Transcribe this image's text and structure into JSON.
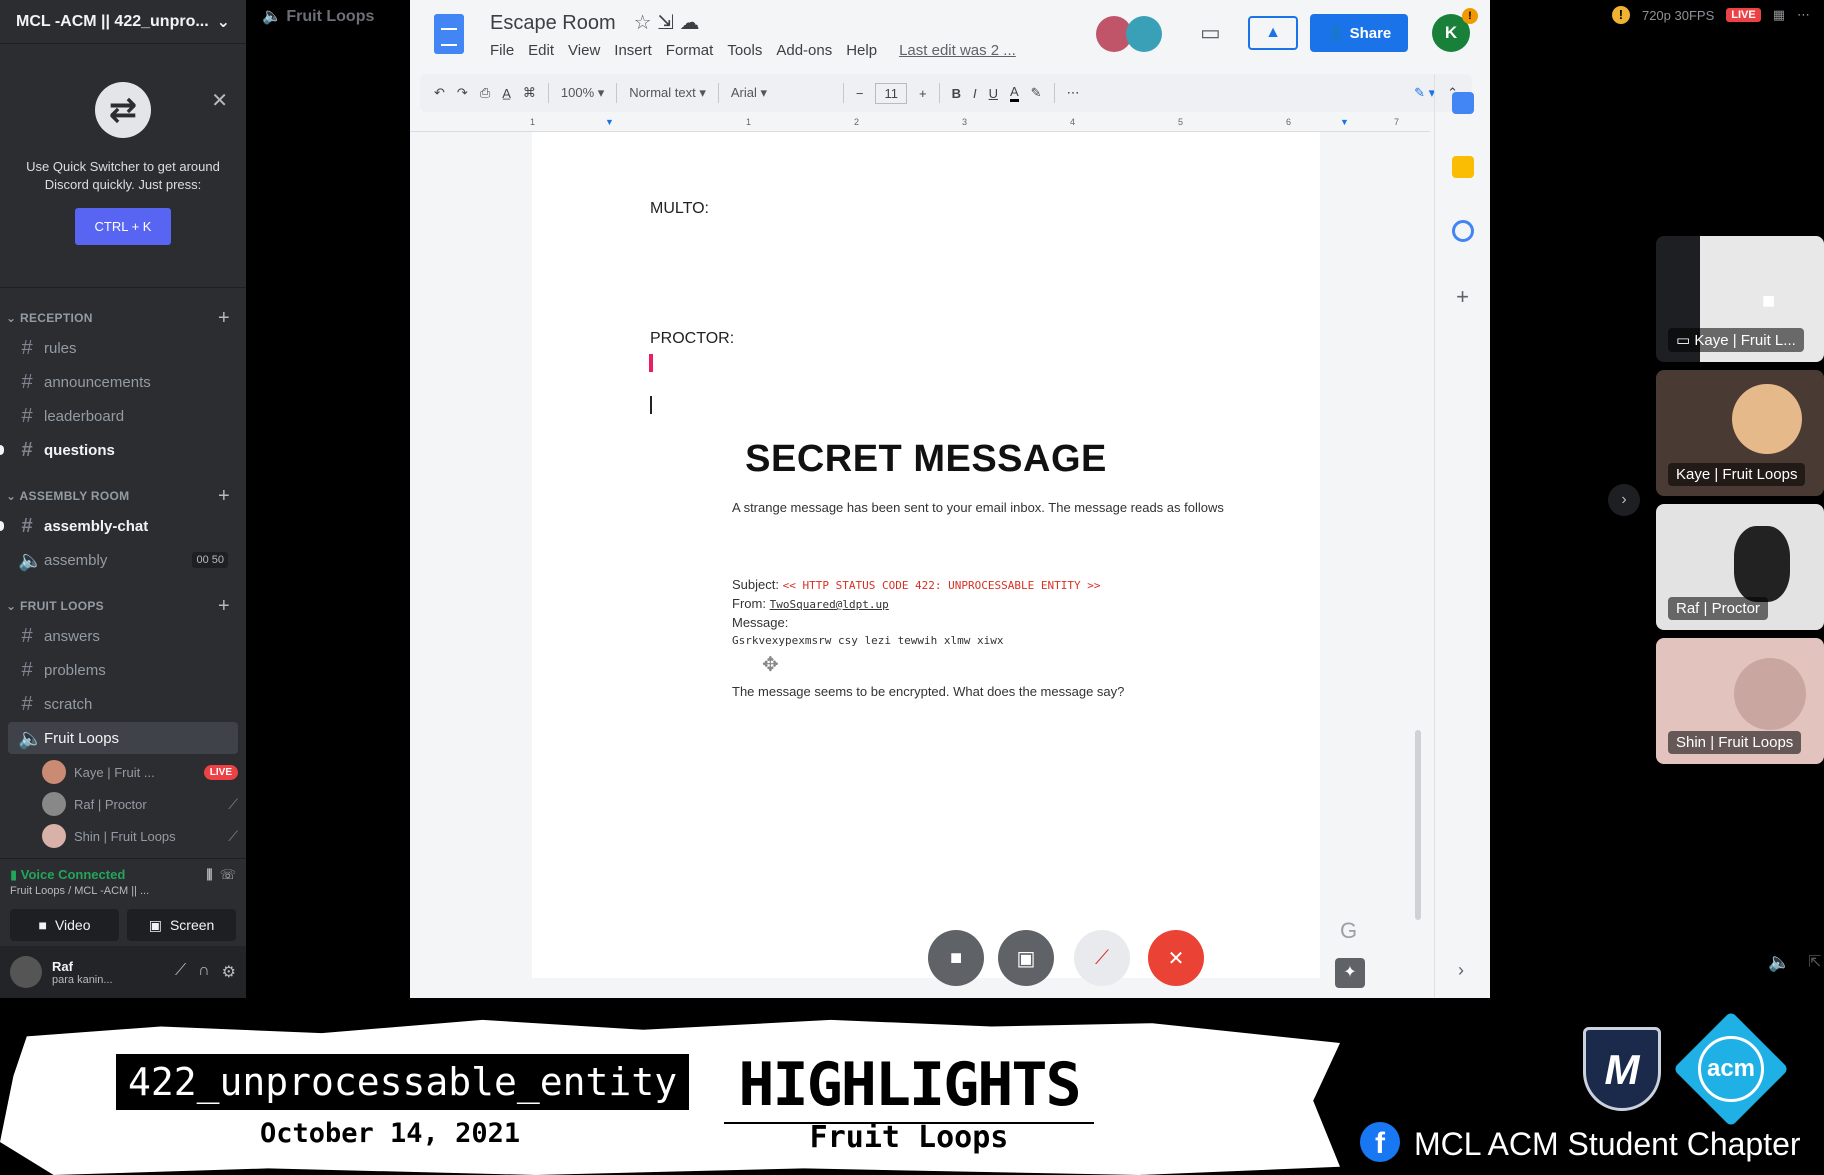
{
  "discord": {
    "server_name": "MCL -ACM || 422_unpro...",
    "quick_switcher": {
      "text": "Use Quick Switcher to get around Discord quickly. Just press:",
      "shortcut": "CTRL + K"
    },
    "categories": [
      {
        "name": "RECEPTION",
        "channels": [
          "rules",
          "announcements",
          "leaderboard",
          "questions"
        ]
      },
      {
        "name": "ASSEMBLY ROOM",
        "channels": [
          "assembly-chat",
          "assembly"
        ],
        "assembly_count": "00 50"
      },
      {
        "name": "FRUIT LOOPS",
        "channels": [
          "answers",
          "problems",
          "scratch",
          "Fruit Loops"
        ]
      }
    ],
    "voice_users": [
      {
        "name": "Kaye | Fruit ...",
        "badge": "LIVE"
      },
      {
        "name": "Raf | Proctor"
      },
      {
        "name": "Shin | Fruit Loops"
      }
    ],
    "voice_status": "Voice Connected",
    "voice_sub": "Fruit Loops / MCL -ACM || ...",
    "video_label": "Video",
    "screen_label": "Screen",
    "user_name": "Raf",
    "user_status": "para kanin..."
  },
  "top_bar": {
    "channel": "Fruit Loops",
    "quality": "720p 30FPS",
    "live": "LIVE"
  },
  "docs": {
    "title": "Escape Room",
    "menu": [
      "File",
      "Edit",
      "View",
      "Insert",
      "Format",
      "Tools",
      "Add-ons",
      "Help"
    ],
    "last_edit": "Last edit was 2 ...",
    "share": "Share",
    "account_initial": "K",
    "zoom": "100%",
    "style": "Normal text",
    "font": "Arial",
    "font_size": "11",
    "ruler": [
      "1",
      "1",
      "2",
      "3",
      "4",
      "5",
      "6",
      "7"
    ],
    "labels": {
      "multo": "MULTO:",
      "proctor": "PROCTOR:"
    },
    "secret_title": "SECRET MESSAGE",
    "intro": "A strange message has been sent to your email inbox. The message reads as follows",
    "subject_label": "Subject:",
    "subject_value": "<< HTTP STATUS CODE 422: UNPROCESSABLE ENTITY >>",
    "from_label": "From:",
    "from_value": "TwoSquared@ldpt.up",
    "message_label": "Message:",
    "message_value": "Gsrkvexypexmsrw csy lezi tewwih xlmw xiwx",
    "question": "The message seems to be encrypted. What does the message say?"
  },
  "tiles": [
    "Kaye | Fruit L...",
    "Kaye | Fruit Loops",
    "Raf | Proctor",
    "Shin | Fruit Loops"
  ],
  "banner": {
    "topic": "422_unprocessable_entity",
    "date": "October 14, 2021",
    "highlights": "HIGHLIGHTS",
    "team": "Fruit Loops",
    "org": "MCL ACM Student Chapter"
  }
}
